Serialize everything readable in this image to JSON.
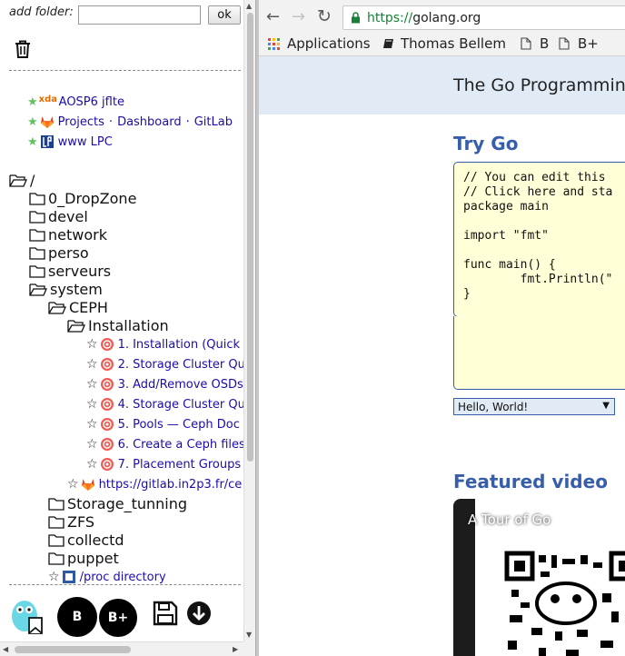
{
  "left_panel": {
    "add_folder_label": "add folder:",
    "add_folder_value": "",
    "ok_label": "ok",
    "pinned": [
      {
        "favicon": "xda",
        "label": "AOSP6 jflte"
      },
      {
        "favicon": "gitlab-icon",
        "links": [
          "Projects",
          "Dashboard",
          "GitLab"
        ],
        "separator": "·"
      },
      {
        "favicon": "lpc-icon",
        "label": "www LPC"
      }
    ],
    "root_label": "/",
    "folders": [
      "0_DropZone",
      "devel",
      "network",
      "perso",
      "serveurs",
      "system"
    ],
    "system_children": {
      "ceph": "CEPH",
      "installation": "Installation",
      "ceph_links": [
        "1. Installation (Quick",
        "2. Storage Cluster Qu",
        "3. Add/Remove OSDs",
        "4. Storage Cluster Qu",
        "5. Pools — Ceph Doc",
        "6. Create a Ceph files",
        "7. Placement Groups"
      ],
      "gitlab_link": "https://gitlab.in2p3.fr/ce",
      "more_folders": [
        "Storage_tunning",
        "ZFS",
        "collectd",
        "puppet"
      ],
      "proc_link": "/proc directory"
    },
    "bottom_buttons": {
      "b": "B",
      "bplus": "B+"
    }
  },
  "browser": {
    "url_scheme": "https://",
    "url_host": "golang.org",
    "bookmarks_bar": [
      {
        "icon": "apps-icon",
        "label": "Applications"
      },
      {
        "icon": "book-icon",
        "label": "Thomas Bellem"
      },
      {
        "icon": "page-icon",
        "label": "B"
      },
      {
        "icon": "page-icon",
        "label": "B+"
      }
    ],
    "page": {
      "header_title": "The Go Programmin",
      "try_go": "Try Go",
      "code": "// You can edit this\n// Click here and sta\npackage main\n\nimport \"fmt\"\n\nfunc main() {\n\tfmt.Println(\"\n}",
      "select_value": "Hello, World!",
      "featured_video": "Featured video",
      "video_title": "A Tour of Go"
    }
  },
  "colors": {
    "link": "#1a0dab",
    "go_blue": "#375eab",
    "go_header_bg": "#e0ebf5",
    "code_bg": "#ffffd8",
    "green_star": "#5ec35e"
  }
}
